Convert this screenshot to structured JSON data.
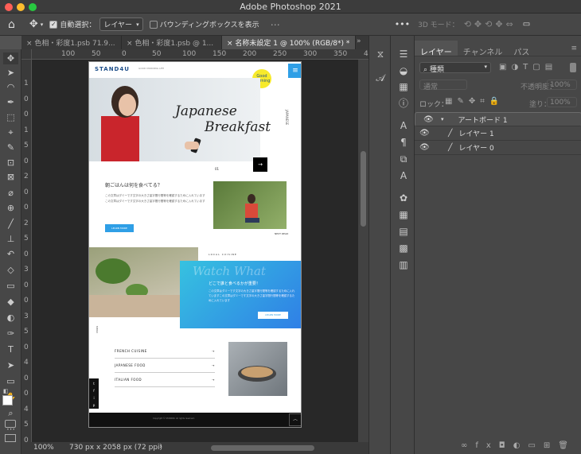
{
  "app": {
    "title": "Adobe Photoshop 2021"
  },
  "colors": {
    "window_close": "#ff5f57",
    "window_minimize": "#febc2e",
    "window_zoom": "#28c840",
    "accent": "#2f9fe6"
  },
  "options": {
    "auto_select_label": "自動選択：",
    "auto_select_value": "レイヤー",
    "bbox_label": "バウンディングボックスを表示",
    "three_d_label": "3D モード："
  },
  "tabs": [
    {
      "label": "色相・彩度1.psb 71.9..."
    },
    {
      "label": "色相・彩度1.psb @ 1..."
    },
    {
      "label": "名称未設定 1 @ 100% (RGB/8*) *"
    }
  ],
  "ruler": {
    "h": [
      "100",
      "50",
      "0",
      "50",
      "100",
      "150",
      "200",
      "250",
      "300",
      "350",
      "400",
      "450"
    ],
    "v": [
      "1",
      "0",
      "0",
      "1",
      "5",
      "0",
      "2",
      "0",
      "0",
      "2",
      "5",
      "0",
      "3",
      "0",
      "0",
      "3",
      "5",
      "0",
      "4",
      "0",
      "0",
      "4",
      "5",
      "0"
    ]
  },
  "status": {
    "zoom": "100%",
    "size": "730 px x 2058 px (72 ppi)",
    "arrow": "›"
  },
  "artboard": {
    "logo": "STAND4U",
    "sublogo": "GOOD MORNING LIFE",
    "badge": "Good morning",
    "hero_title_1": "Japanese",
    "hero_title_2": "Breakfast",
    "side_text": "JAPANESE",
    "pager": "01",
    "q_heading": "朝ごはんは何を食べてる？",
    "q_body": "この文章はダミーです文字の大きさ量字間行間等を確認するために入れていますこの文章はダミーです文字の大きさ量字間行間等を確認するために入れています",
    "learn_more": "LEARN MORE",
    "next_caption": "NEXT READ",
    "local_cuisine": "LOCAL CUISINE",
    "blue_script": "Watch What",
    "blue_heading": "どこで誰と食べるかが重要！",
    "blue_body": "この文章はダミーです文字の大きさ量字間行間等を確認するために入れていますこの文章はダミーです文字の大きさ量字間行間等を確認するために入れています",
    "blue_button": "LEARN MORE",
    "menu_side": "MENU",
    "menu": [
      {
        "label": "FRENCH CUISINE",
        "arrow": "→"
      },
      {
        "label": "JAPANESE FOOD",
        "arrow": "→"
      },
      {
        "label": "ITALIAN FOOD",
        "arrow": "→"
      }
    ],
    "social": [
      "t",
      "f",
      "i",
      "p"
    ],
    "footer": "Copyright © STAND4U All rights reserved."
  },
  "panel": {
    "tabs": [
      "レイヤー",
      "チャンネル",
      "パス"
    ],
    "filter": "種類",
    "blend": "通常",
    "opacity_label": "不透明度：",
    "opacity": "100%",
    "lock_label": "ロック：",
    "fill_label": "塗り：",
    "fill": "100%",
    "layers": [
      {
        "name": "アートボード 1",
        "kind": "artboard"
      },
      {
        "name": "レイヤー 1",
        "kind": "layer"
      },
      {
        "name": "レイヤー 0",
        "kind": "layer"
      }
    ]
  }
}
